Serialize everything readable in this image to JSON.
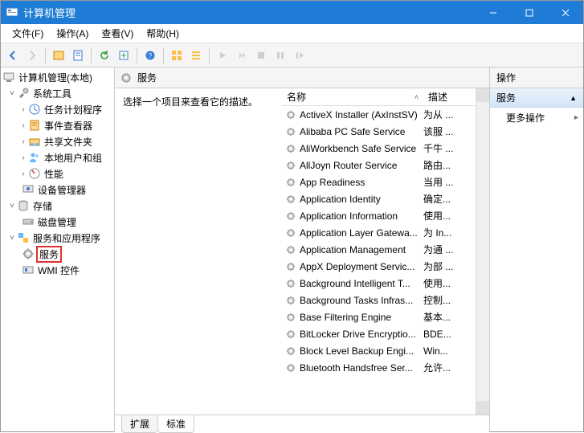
{
  "window": {
    "title": "计算机管理"
  },
  "menubar": {
    "file": "文件(F)",
    "operation": "操作(A)",
    "view": "查看(V)",
    "help": "帮助(H)"
  },
  "tree": {
    "root": "计算机管理(本地)",
    "system_tools": "系统工具",
    "task_scheduler": "任务计划程序",
    "event_viewer": "事件查看器",
    "shared_folders": "共享文件夹",
    "local_users": "本地用户和组",
    "performance": "性能",
    "device_manager": "设备管理器",
    "storage": "存储",
    "disk_management": "磁盘管理",
    "services_apps": "服务和应用程序",
    "services": "服务",
    "wmi_control": "WMI 控件"
  },
  "center": {
    "header": "服务",
    "detail_prompt": "选择一个项目来查看它的描述。",
    "cols": {
      "name": "名称",
      "desc": "描述"
    },
    "services": [
      {
        "name": "ActiveX Installer (AxInstSV)",
        "desc": "为从 ..."
      },
      {
        "name": "Alibaba PC Safe Service",
        "desc": "该服 ..."
      },
      {
        "name": "AliWorkbench Safe Service",
        "desc": "千牛 ..."
      },
      {
        "name": "AllJoyn Router Service",
        "desc": "路由..."
      },
      {
        "name": "App Readiness",
        "desc": "当用 ..."
      },
      {
        "name": "Application Identity",
        "desc": "确定..."
      },
      {
        "name": "Application Information",
        "desc": "使用..."
      },
      {
        "name": "Application Layer Gatewa...",
        "desc": "为 In..."
      },
      {
        "name": "Application Management",
        "desc": "为通 ..."
      },
      {
        "name": "AppX Deployment Servic...",
        "desc": "为部 ..."
      },
      {
        "name": "Background Intelligent T...",
        "desc": "使用..."
      },
      {
        "name": "Background Tasks Infras...",
        "desc": "控制..."
      },
      {
        "name": "Base Filtering Engine",
        "desc": "基本..."
      },
      {
        "name": "BitLocker Drive Encryptio...",
        "desc": "BDE..."
      },
      {
        "name": "Block Level Backup Engi...",
        "desc": "Win..."
      },
      {
        "name": "Bluetooth Handsfree Ser...",
        "desc": "允许..."
      }
    ],
    "tabs": {
      "extended": "扩展",
      "standard": "标准"
    }
  },
  "actions": {
    "title": "操作",
    "group": "服务",
    "more": "更多操作"
  }
}
